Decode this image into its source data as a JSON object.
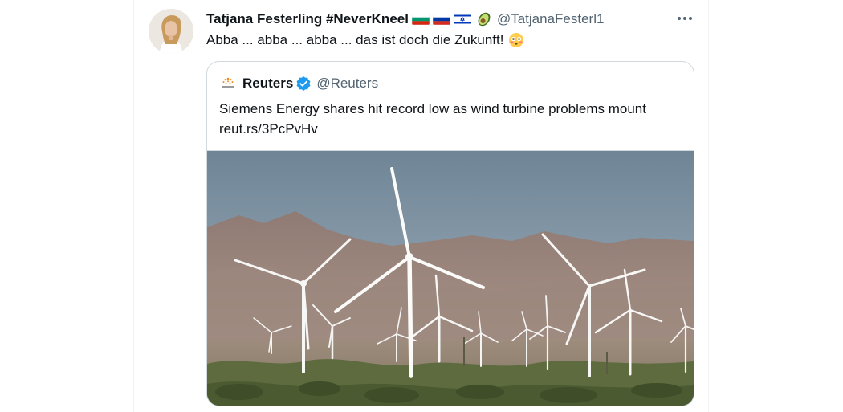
{
  "tweet": {
    "display_name": "Tatjana Festerling #NeverKneel",
    "handle": "@TatjanaFesterl1",
    "text": "Abba ... abba ... abba ... das ist doch die Zukunft!",
    "emojis": [
      "bulgaria-flag",
      "russia-flag",
      "israel-flag",
      "avocado",
      "flushed-face"
    ]
  },
  "quote": {
    "name": "Reuters",
    "handle": "@Reuters",
    "verified": true,
    "text": "Siemens Energy shares hit record low as wind turbine problems mount",
    "link": "reut.rs/3PcPvHv",
    "image": "wind-turbines-photo"
  },
  "colors": {
    "text": "#0f1419",
    "secondary": "#536471",
    "border": "#cfd9de",
    "verified": "#1d9bf0"
  }
}
